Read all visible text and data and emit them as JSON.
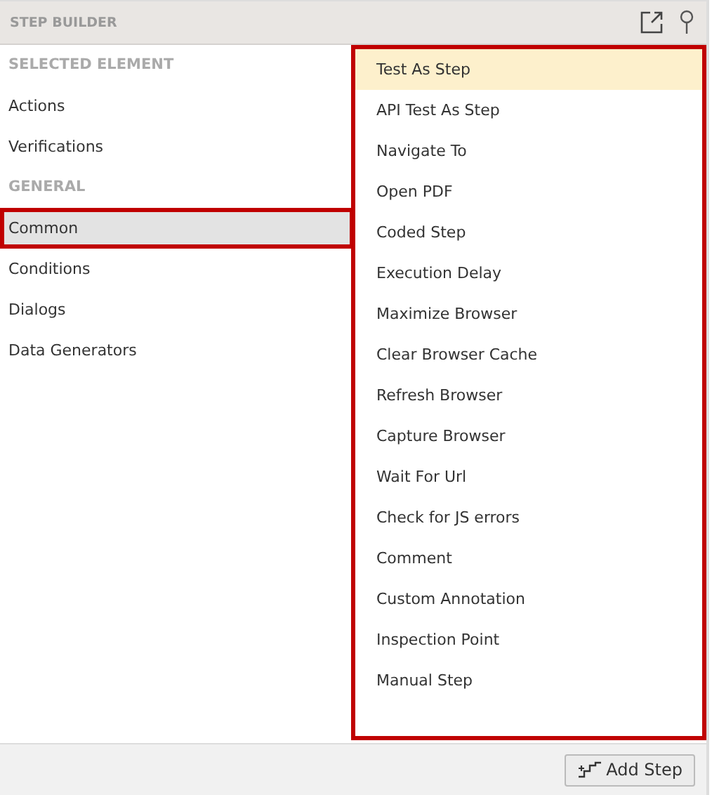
{
  "panel": {
    "title": "STEP BUILDER"
  },
  "categories": [
    {
      "kind": "header",
      "label": "SELECTED ELEMENT"
    },
    {
      "kind": "item",
      "label": "Actions",
      "selected": false
    },
    {
      "kind": "item",
      "label": "Verifications",
      "selected": false
    },
    {
      "kind": "header",
      "label": "GENERAL"
    },
    {
      "kind": "item",
      "label": "Common",
      "selected": true
    },
    {
      "kind": "item",
      "label": "Conditions",
      "selected": false
    },
    {
      "kind": "item",
      "label": "Dialogs",
      "selected": false
    },
    {
      "kind": "item",
      "label": "Data Generators",
      "selected": false
    }
  ],
  "steps": {
    "outlined": true,
    "items": [
      {
        "label": "Test As Step",
        "selected": true
      },
      {
        "label": "API Test As Step",
        "selected": false
      },
      {
        "label": "Navigate To",
        "selected": false
      },
      {
        "label": "Open PDF",
        "selected": false
      },
      {
        "label": "Coded Step",
        "selected": false
      },
      {
        "label": "Execution Delay",
        "selected": false
      },
      {
        "label": "Maximize Browser",
        "selected": false
      },
      {
        "label": "Clear Browser Cache",
        "selected": false
      },
      {
        "label": "Refresh Browser",
        "selected": false
      },
      {
        "label": "Capture Browser",
        "selected": false
      },
      {
        "label": "Wait For Url",
        "selected": false
      },
      {
        "label": "Check for JS errors",
        "selected": false
      },
      {
        "label": "Comment",
        "selected": false
      },
      {
        "label": "Custom Annotation",
        "selected": false
      },
      {
        "label": "Inspection Point",
        "selected": false
      },
      {
        "label": "Manual Step",
        "selected": false
      }
    ]
  },
  "add_button": {
    "label": "Add Step"
  }
}
